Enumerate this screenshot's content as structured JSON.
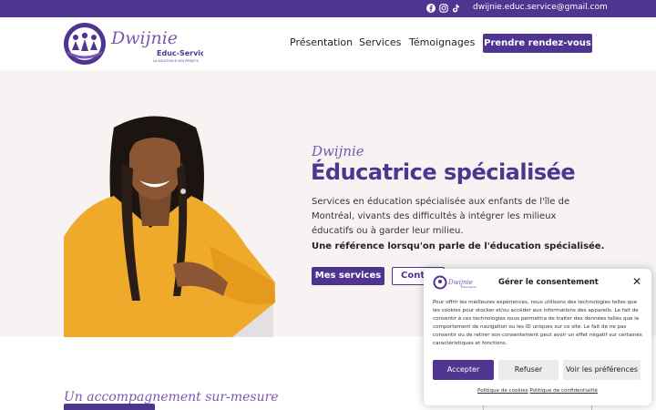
{
  "topbar": {
    "email": "dwijnie.educ.service@gmail.com",
    "social_icons": [
      "facebook-icon",
      "instagram-icon",
      "tiktok-icon"
    ],
    "background": "#4f3590"
  },
  "brand": {
    "name": "Dwijnie",
    "subtitle": "Educ-Service",
    "tagline": "LA SOLUTION À VOS PROJETS"
  },
  "nav": {
    "items": [
      {
        "label": "Présentation"
      },
      {
        "label": "Services"
      },
      {
        "label": "Témoignages"
      }
    ],
    "cta_label": "Prendre rendez-vous"
  },
  "hero": {
    "script_title": "Dwijnie",
    "title": "Éducatrice spécialisée",
    "description": "Services en éducation spécialisée aux enfants de l'île de Montréal, vivants des difficultés à intégrer les milieux éducatifs ou à garder leur milieu.",
    "tagline": "Une référence lorsqu'on parle de l'éducation spécialisée.",
    "primary_button": "Mes services",
    "secondary_button": "Contact"
  },
  "section2": {
    "script_title": "Un accompagnement sur-mesure"
  },
  "cookie_banner": {
    "title": "Gérer le consentement",
    "text": "Pour offrir les meilleures expériences, nous utilisons des technologies telles que les cookies pour stocker et/ou accéder aux informations des appareils. Le fait de consentir à ces technologies nous permettra de traiter des données telles que le comportement de navigation ou les ID uniques sur ce site. Le fait de ne pas consentir ou de retirer son consentement peut avoir un effet négatif sur certaines caractéristiques et fonctions.",
    "accept_label": "Accepter",
    "refuse_label": "Refuser",
    "prefs_label": "Voir les préférences",
    "cookie_policy_link": "Politique de cookies",
    "privacy_policy_link": "Politique de confidentialité"
  },
  "colors": {
    "brand_purple": "#4f3590",
    "accent_lavender": "#7a58b0",
    "hero_background": "#f7f3f2"
  }
}
